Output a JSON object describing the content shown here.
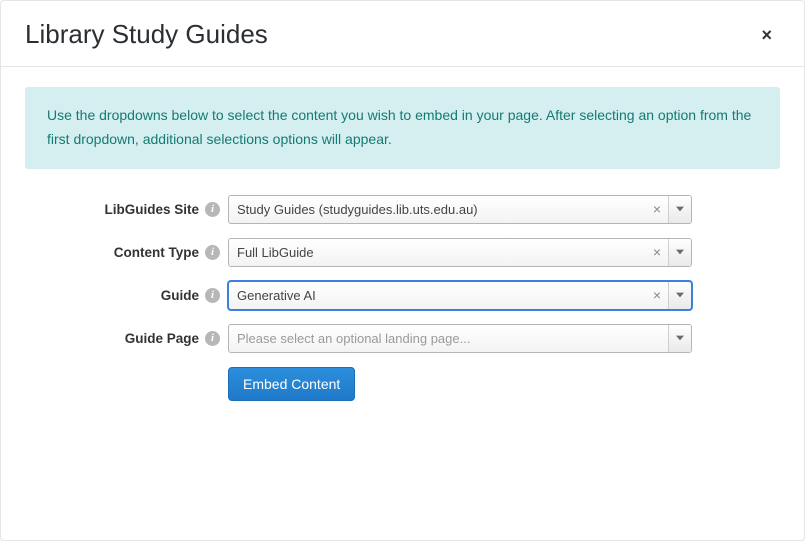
{
  "header": {
    "title": "Library Study Guides"
  },
  "banner": {
    "text": "Use the dropdowns below to select the content you wish to embed in your page. After selecting an option from the first dropdown, additional selections options will appear."
  },
  "fields": {
    "site": {
      "label": "LibGuides Site",
      "value": "Study Guides (studyguides.lib.uts.edu.au)"
    },
    "contentType": {
      "label": "Content Type",
      "value": "Full LibGuide"
    },
    "guide": {
      "label": "Guide",
      "value": "Generative AI"
    },
    "guidePage": {
      "label": "Guide Page",
      "placeholder": "Please select an optional landing page..."
    }
  },
  "actions": {
    "embed": "Embed Content"
  },
  "glyphs": {
    "close": "×",
    "clear": "×",
    "info": "i"
  }
}
